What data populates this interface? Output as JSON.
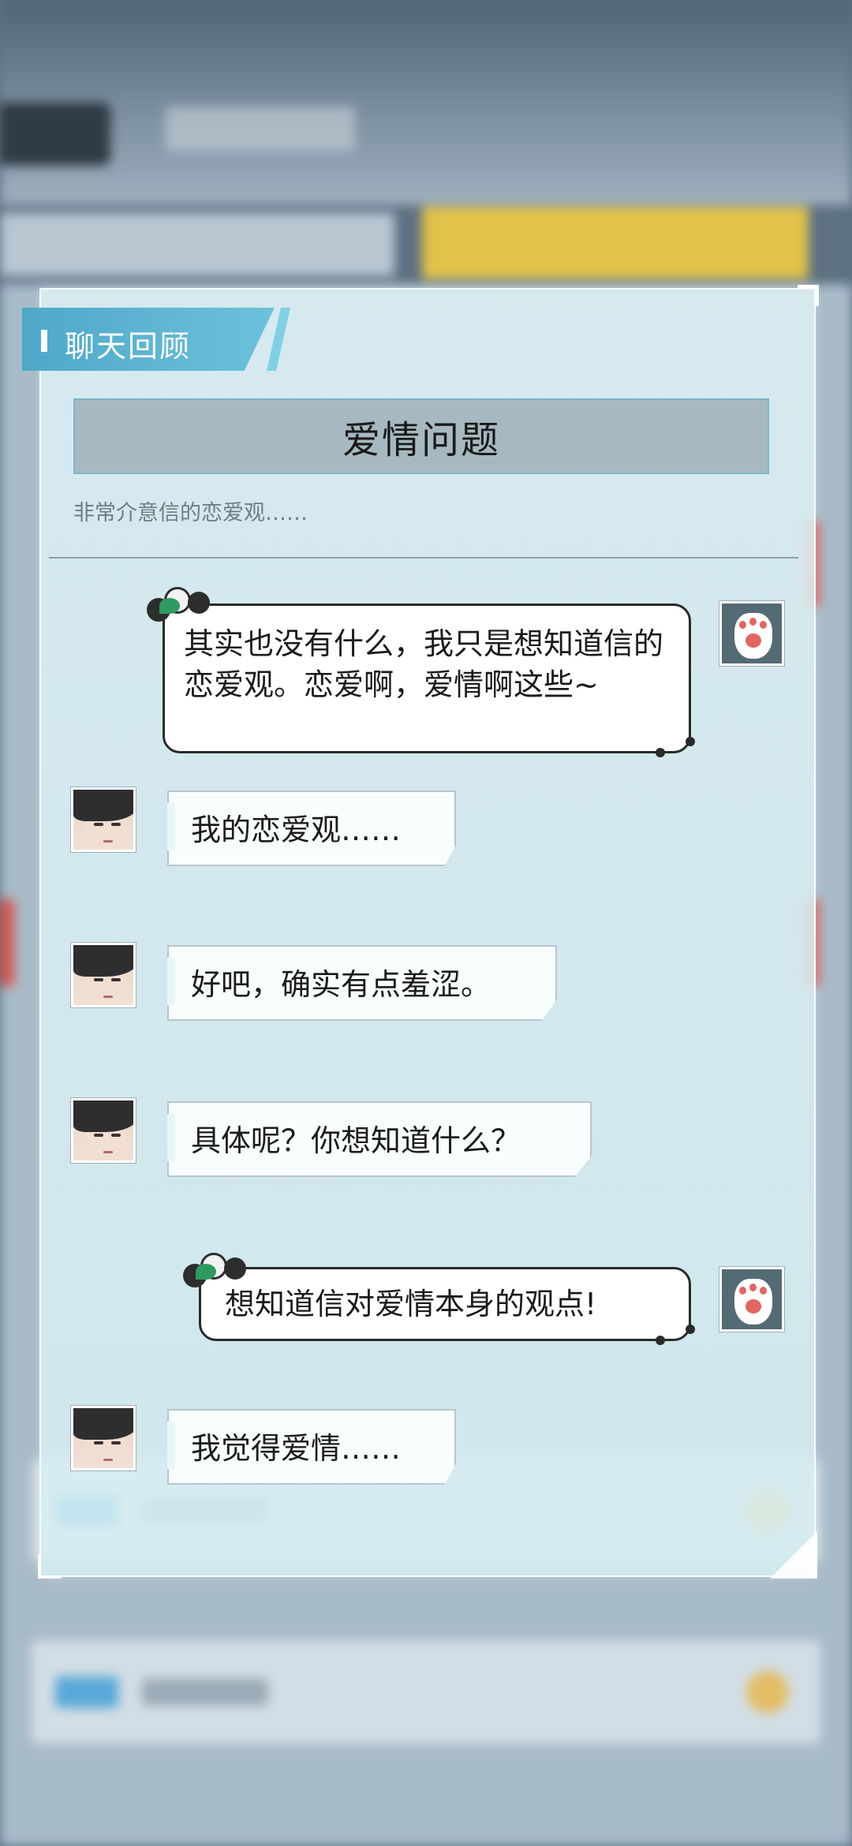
{
  "panel": {
    "title": "聊天回顾",
    "topic": "爱情问题",
    "subtitle": "非常介意信的恋爱观……"
  },
  "messages": [
    {
      "speaker": "player",
      "avatar_icon": "cat-paw-icon",
      "text": "其实也没有什么，我只是想知道信的恋爱观。恋爱啊，爱情啊这些~"
    },
    {
      "speaker": "character",
      "avatar_icon": "character-portrait",
      "text": "我的恋爱观……"
    },
    {
      "speaker": "character",
      "avatar_icon": "character-portrait",
      "text": "好吧，确实有点羞涩。"
    },
    {
      "speaker": "character",
      "avatar_icon": "character-portrait",
      "text": "具体呢？你想知道什么？"
    },
    {
      "speaker": "player",
      "avatar_icon": "cat-paw-icon",
      "text": "想知道信对爱情本身的观点!"
    },
    {
      "speaker": "character",
      "avatar_icon": "character-portrait",
      "text": "我觉得爱情……"
    }
  ],
  "colors": {
    "accent": "#4ea8c8",
    "panel_bg": "#d6eef2",
    "topic_bg": "#a6b9c0",
    "paw_pad": "#e26560"
  }
}
